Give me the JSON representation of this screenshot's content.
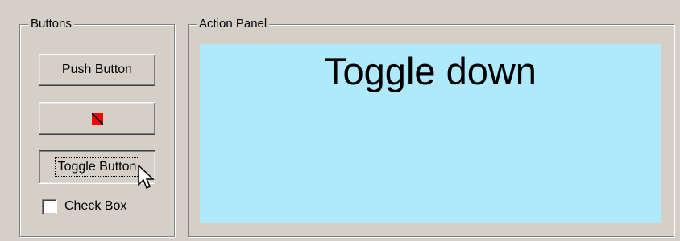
{
  "buttons_group": {
    "title": "Buttons",
    "push_button_label": "Push Button",
    "icon_button_icon": "no-entry-icon",
    "toggle_button_label": "Toggle Button",
    "toggle_pressed": true,
    "checkbox_label": "Check Box",
    "checkbox_checked": false
  },
  "action_group": {
    "title": "Action Panel",
    "panel_text": "Toggle down",
    "panel_color": "#aee9fc"
  },
  "colors": {
    "window_bg": "#d4d0c8",
    "icon_red": "#ff0000"
  }
}
